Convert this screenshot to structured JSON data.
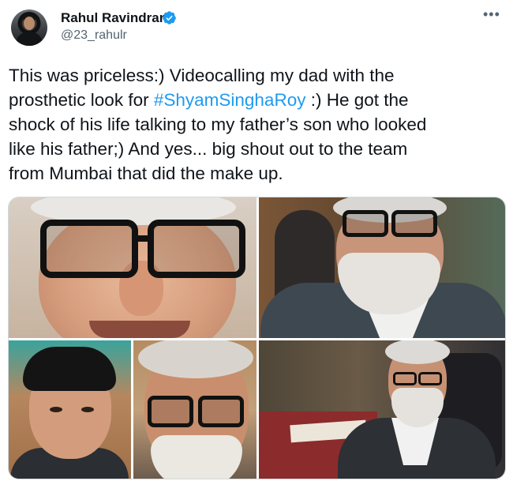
{
  "author": {
    "name": "Rahul Ravindran",
    "handle": "@23_rahulr",
    "verified_icon": "verified-badge-icon",
    "avatar_icon": "profile-avatar"
  },
  "menu": {
    "more_label": "•••"
  },
  "tweet": {
    "lines": [
      {
        "text": "This was priceless:) Videocalling my dad with the"
      },
      {
        "pre": "prosthetic look for ",
        "hashtag": "#ShyamSinghaRoy",
        "post": " :) He got the"
      },
      {
        "text": "shock of his life talking to my father’s son who looked"
      },
      {
        "text": "like his father;) And yes... big shout out to the team"
      },
      {
        "text": "from Mumbai that did the make up."
      }
    ]
  },
  "colors": {
    "hashtag": "#1d9bf0",
    "text": "#0f1419",
    "secondary": "#536471",
    "verified": "#1d9bf0"
  }
}
